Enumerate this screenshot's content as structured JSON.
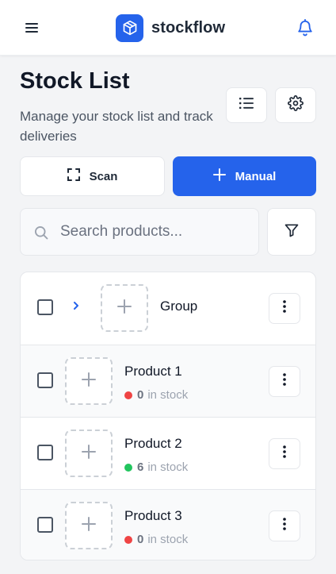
{
  "header": {
    "menu_icon": "hamburger-menu-icon",
    "logo_icon": "cube-icon",
    "brand": "stockflow",
    "notification_icon": "bell-icon"
  },
  "page": {
    "title": "Stock List",
    "subtitle": "Manage your stock list and track deliveries"
  },
  "toolbar": {
    "list_view_icon": "list-view-icon",
    "settings_icon": "gear-icon",
    "scan_label": "Scan",
    "scan_icon": "scan-frame-icon",
    "manual_label": "Manual",
    "manual_icon": "plus-icon"
  },
  "search": {
    "placeholder": "Search products...",
    "value": "",
    "icon": "search-icon",
    "filter_icon": "filter-icon"
  },
  "colors": {
    "accent": "#2563eb",
    "out_of_stock": "#ef4444",
    "in_stock": "#22c55e"
  },
  "items": [
    {
      "type": "group",
      "name": "Group"
    },
    {
      "type": "product",
      "name": "Product 1",
      "count": "0",
      "stock_label": "in stock",
      "status": "out"
    },
    {
      "type": "product",
      "name": "Product 2",
      "count": "6",
      "stock_label": "in stock",
      "status": "in"
    },
    {
      "type": "product",
      "name": "Product 3",
      "count": "0",
      "stock_label": "in stock",
      "status": "out"
    }
  ]
}
